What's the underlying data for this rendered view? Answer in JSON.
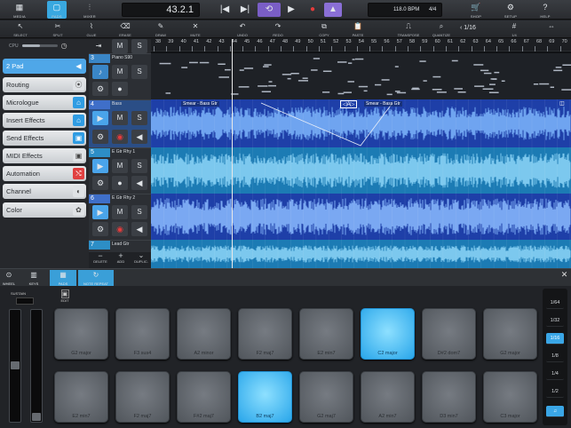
{
  "toolbar": {
    "buttons": [
      {
        "label": "MEDIA",
        "icon": "▦",
        "active": false
      },
      {
        "label": "PADS",
        "icon": "▢",
        "active": true
      },
      {
        "label": "MIXER",
        "icon": "⫶",
        "active": false
      }
    ],
    "position": "43.2.1",
    "tempo": "118.0 BPM",
    "signature": "4/4",
    "right_buttons": [
      {
        "label": "SHOP",
        "icon": "🛒"
      },
      {
        "label": "SETUP",
        "icon": "⚙"
      },
      {
        "label": "HELP",
        "icon": "?"
      }
    ]
  },
  "tools": {
    "items": [
      {
        "label": "SELECT",
        "icon": "↖"
      },
      {
        "label": "SPLIT",
        "icon": "✂"
      },
      {
        "label": "GLUE",
        "icon": "⌇"
      },
      {
        "label": "ERASE",
        "icon": "⌫"
      },
      {
        "label": "DRAW",
        "icon": "✎"
      },
      {
        "label": "MUTE",
        "icon": "✕"
      },
      {
        "label": "UNDO",
        "icon": "↶"
      },
      {
        "label": "REDO",
        "icon": "↷"
      },
      {
        "label": "COPY",
        "icon": "⧉"
      },
      {
        "label": "PASTE",
        "icon": "📋"
      },
      {
        "label": "TRANSPOSE",
        "icon": "⎍"
      },
      {
        "label": "QUANTIZE",
        "icon": "⌕"
      }
    ],
    "quantize_value": "1/16",
    "grid_label": "1/4"
  },
  "cpu": {
    "label": "CPU",
    "load": 0.5
  },
  "inspector": {
    "items": [
      {
        "label": "2 Pad",
        "icon": "◀"
      },
      {
        "label": "Routing",
        "icon": "⦿"
      },
      {
        "label": "Micrologue",
        "icon": "⌂"
      },
      {
        "label": "Insert Effects",
        "icon": "⌂"
      },
      {
        "label": "Send Effects",
        "icon": "▣"
      },
      {
        "label": "MIDI Effects",
        "icon": "▣"
      },
      {
        "label": "Automation",
        "icon": "⤭"
      },
      {
        "label": "Channel",
        "icon": "◐"
      },
      {
        "label": "Color",
        "icon": "✿"
      }
    ]
  },
  "tracks": [
    {
      "num": "3",
      "name": "Piano S90"
    },
    {
      "num": "4",
      "name": "Bass",
      "clips": [
        "Smear - Bass Gtr",
        "Smear - Bass Gtr"
      ]
    },
    {
      "num": "5",
      "name": "E Gtr Rhy 1"
    },
    {
      "num": "6",
      "name": "E Gtr Rhy 2"
    },
    {
      "num": "7",
      "name": "Lead Gtr"
    }
  ],
  "track_controls": {
    "mute": "M",
    "solo": "S",
    "delete": "DELETE",
    "add": "ADD",
    "duplicate": "DUPLIC."
  },
  "ruler": [
    "38",
    "39",
    "40",
    "41",
    "42",
    "43",
    "44",
    "45",
    "46",
    "47",
    "48",
    "49",
    "50",
    "51",
    "52",
    "53",
    "54",
    "55",
    "56",
    "57",
    "58",
    "59",
    "60",
    "61",
    "62",
    "63",
    "64",
    "65",
    "66",
    "67",
    "68",
    "69",
    "70",
    "71"
  ],
  "padbar": {
    "items": [
      {
        "label": "WHEEL",
        "icon": "⊙"
      },
      {
        "label": "KEYS",
        "icon": "▥"
      },
      {
        "label": "PADS",
        "icon": "▦"
      },
      {
        "label": "NOTE REPEAT",
        "icon": "↻"
      }
    ],
    "edit": "EDIT",
    "sustain": "SUSTAIN"
  },
  "pads": {
    "row1": [
      {
        "label": "G2 major",
        "lit": false
      },
      {
        "label": "F3 sus4",
        "lit": false
      },
      {
        "label": "A2 minor",
        "lit": false
      },
      {
        "label": "F2 maj7",
        "lit": false
      },
      {
        "label": "E2 min7",
        "lit": false
      },
      {
        "label": "C2 major",
        "lit": true
      },
      {
        "label": "D#2 dom7",
        "lit": false
      },
      {
        "label": "G2 major",
        "lit": false
      }
    ],
    "row2": [
      {
        "label": "E2 min7",
        "lit": false
      },
      {
        "label": "F2 maj7",
        "lit": false
      },
      {
        "label": "F#2 maj7",
        "lit": false
      },
      {
        "label": "B2 maj7",
        "lit": true
      },
      {
        "label": "G2 maj7",
        "lit": false
      },
      {
        "label": "A2 min7",
        "lit": false
      },
      {
        "label": "D3 min7",
        "lit": false
      },
      {
        "label": "C3 major",
        "lit": false
      }
    ]
  },
  "repeat_rates": [
    {
      "label": "1/64",
      "on": false
    },
    {
      "label": "1/32",
      "on": false
    },
    {
      "label": "1/16",
      "on": true
    },
    {
      "label": "1/8",
      "on": false
    },
    {
      "label": "1/4",
      "on": false
    },
    {
      "label": "1/2",
      "on": false
    }
  ],
  "colors": {
    "accent": "#39a8e0",
    "pad_lit": "#29a6ea",
    "loop": "#7a5ec6",
    "record": "#e53b3b",
    "bass_clip": "#1e3fa8",
    "gtr_clip": "#1c7bb4"
  }
}
